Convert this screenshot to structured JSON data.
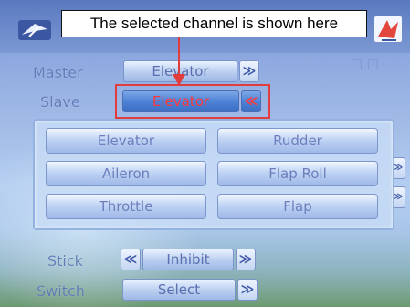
{
  "annotation": {
    "callout_text": "The selected channel is shown here"
  },
  "rows": {
    "master": {
      "label": "Master",
      "value": "Elevator",
      "next_arrow": "≫"
    },
    "slave": {
      "label": "Slave",
      "value": "Elevator",
      "prev_arrow": "≪"
    },
    "stick": {
      "label": "Stick",
      "value": "Inhibit",
      "prev_arrow": "≪",
      "next_arrow": "≫"
    },
    "switch": {
      "label": "Switch",
      "value": "Select",
      "next_arrow": "≫"
    }
  },
  "channel_popup": {
    "options": [
      "Elevator",
      "Rudder",
      "Aileron",
      "Flap Roll",
      "Throttle",
      "Flap"
    ]
  },
  "colors": {
    "selected_text": "#ff3a3a",
    "highlight_border": "#e23c3c"
  },
  "icons": {
    "model": "airplane-model-icon",
    "mix": "mix-flag-icon"
  }
}
